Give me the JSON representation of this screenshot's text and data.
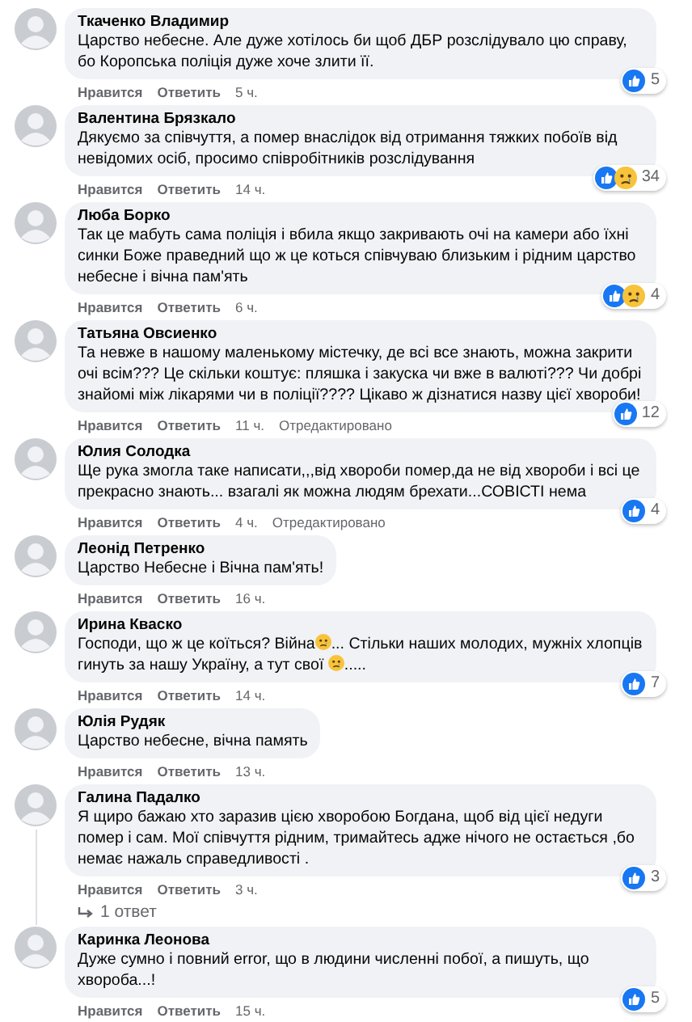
{
  "comments": [
    {
      "author": "Ткаченко Владимир",
      "body": [
        "Царство небесне. Але дуже хотілось би щоб ДБР розслідувало цю справу, бо Коропська поліція дуже хоче злити її."
      ],
      "actions": [
        "Нравится",
        "Ответить"
      ],
      "time": "5 ч.",
      "reactions": [
        {
          "kind": "like"
        }
      ],
      "reaction_count": "5"
    },
    {
      "author": "Валентина Брязкало",
      "body": [
        "Дякуємо за співчуття, а помер внаслідок від отримання тяжких побоїв від невідомих осіб, просимо співробітників розслідування"
      ],
      "actions": [
        "Нравится",
        "Ответить"
      ],
      "time": "14 ч.",
      "reactions": [
        {
          "kind": "like"
        },
        {
          "kind": "sad"
        }
      ],
      "reaction_count": "34"
    },
    {
      "author": "Люба Борко",
      "body": [
        "Так це мабуть сама поліція і вбила якщо закривають очі на камери або їхні синки Боже праведний що ж це коться співчуваю близьким і рідним царство небесне і вічна пам'ять"
      ],
      "actions": [
        "Нравится",
        "Ответить"
      ],
      "time": "6 ч.",
      "reactions": [
        {
          "kind": "like"
        },
        {
          "kind": "sad"
        }
      ],
      "reaction_count": "4"
    },
    {
      "author": "Татьяна Овсиенко",
      "body": [
        "Та невже в нашому маленькому містечку, де всі все знають, можна закрити очі всім??? Це скільки коштує: пляшка і закуска чи вже в валюті??? Чи добрі знайомі між лікарями чи в поліції???? Цікаво ж дізнатися назву цієї хвороби!"
      ],
      "actions": [
        "Нравится",
        "Ответить"
      ],
      "time": "11 ч.",
      "edited": "Отредактировано",
      "reactions": [
        {
          "kind": "like"
        }
      ],
      "reaction_count": "12"
    },
    {
      "author": "Юлия Солодка",
      "body": [
        "Ще рука змогла таке написати,,,від хвороби помер,да не від хвороби і всі це прекрасно знають... взагалі як можна людям брехати...СОВІСТІ нема"
      ],
      "actions": [
        "Нравится",
        "Ответить"
      ],
      "time": "4 ч.",
      "edited": "Отредактировано",
      "reactions": [
        {
          "kind": "like"
        }
      ],
      "reaction_count": "4"
    },
    {
      "author": "Леонід Петренко",
      "body": [
        "Царство Небесне і Вічна пам'ять!"
      ],
      "actions": [
        "Нравится",
        "Ответить"
      ],
      "time": "16 ч."
    },
    {
      "author": "Ирина Кваско",
      "body": [
        "Господи, що ж це коїться? Війна",
        "... Стільки наших молодих, мужніх хлопців гинуть за нашу Україну, а тут свої ",
        "....."
      ],
      "actions": [
        "Нравится",
        "Ответить"
      ],
      "time": "14 ч.",
      "reactions": [
        {
          "kind": "like"
        }
      ],
      "reaction_count": "7"
    },
    {
      "author": "Юлія Рудяк",
      "body": [
        "Царство небесне, вічна память"
      ],
      "actions": [
        "Нравится",
        "Ответить"
      ],
      "time": "13 ч."
    },
    {
      "author": "Галина Падалко",
      "body": [
        "Я щиро бажаю хто заразив цією хворобою Богдана, щоб від цієї недуги помер і сам. Мої співчуття рідним, тримайтесь адже нічого не остається ,бо немає нажаль справедливості ."
      ],
      "actions": [
        "Нравится",
        "Ответить"
      ],
      "time": "3 ч.",
      "reactions": [
        {
          "kind": "like"
        }
      ],
      "reaction_count": "3",
      "replies": "1 ответ"
    },
    {
      "author": "Каринка Леонова",
      "body": [
        "Дуже сумно і повний error, що в людини численні побої, а пишуть, що хвороба...!"
      ],
      "actions": [
        "Нравится",
        "Ответить"
      ],
      "time": "15 ч.",
      "reactions": [
        {
          "kind": "like"
        }
      ],
      "reaction_count": "5"
    }
  ]
}
